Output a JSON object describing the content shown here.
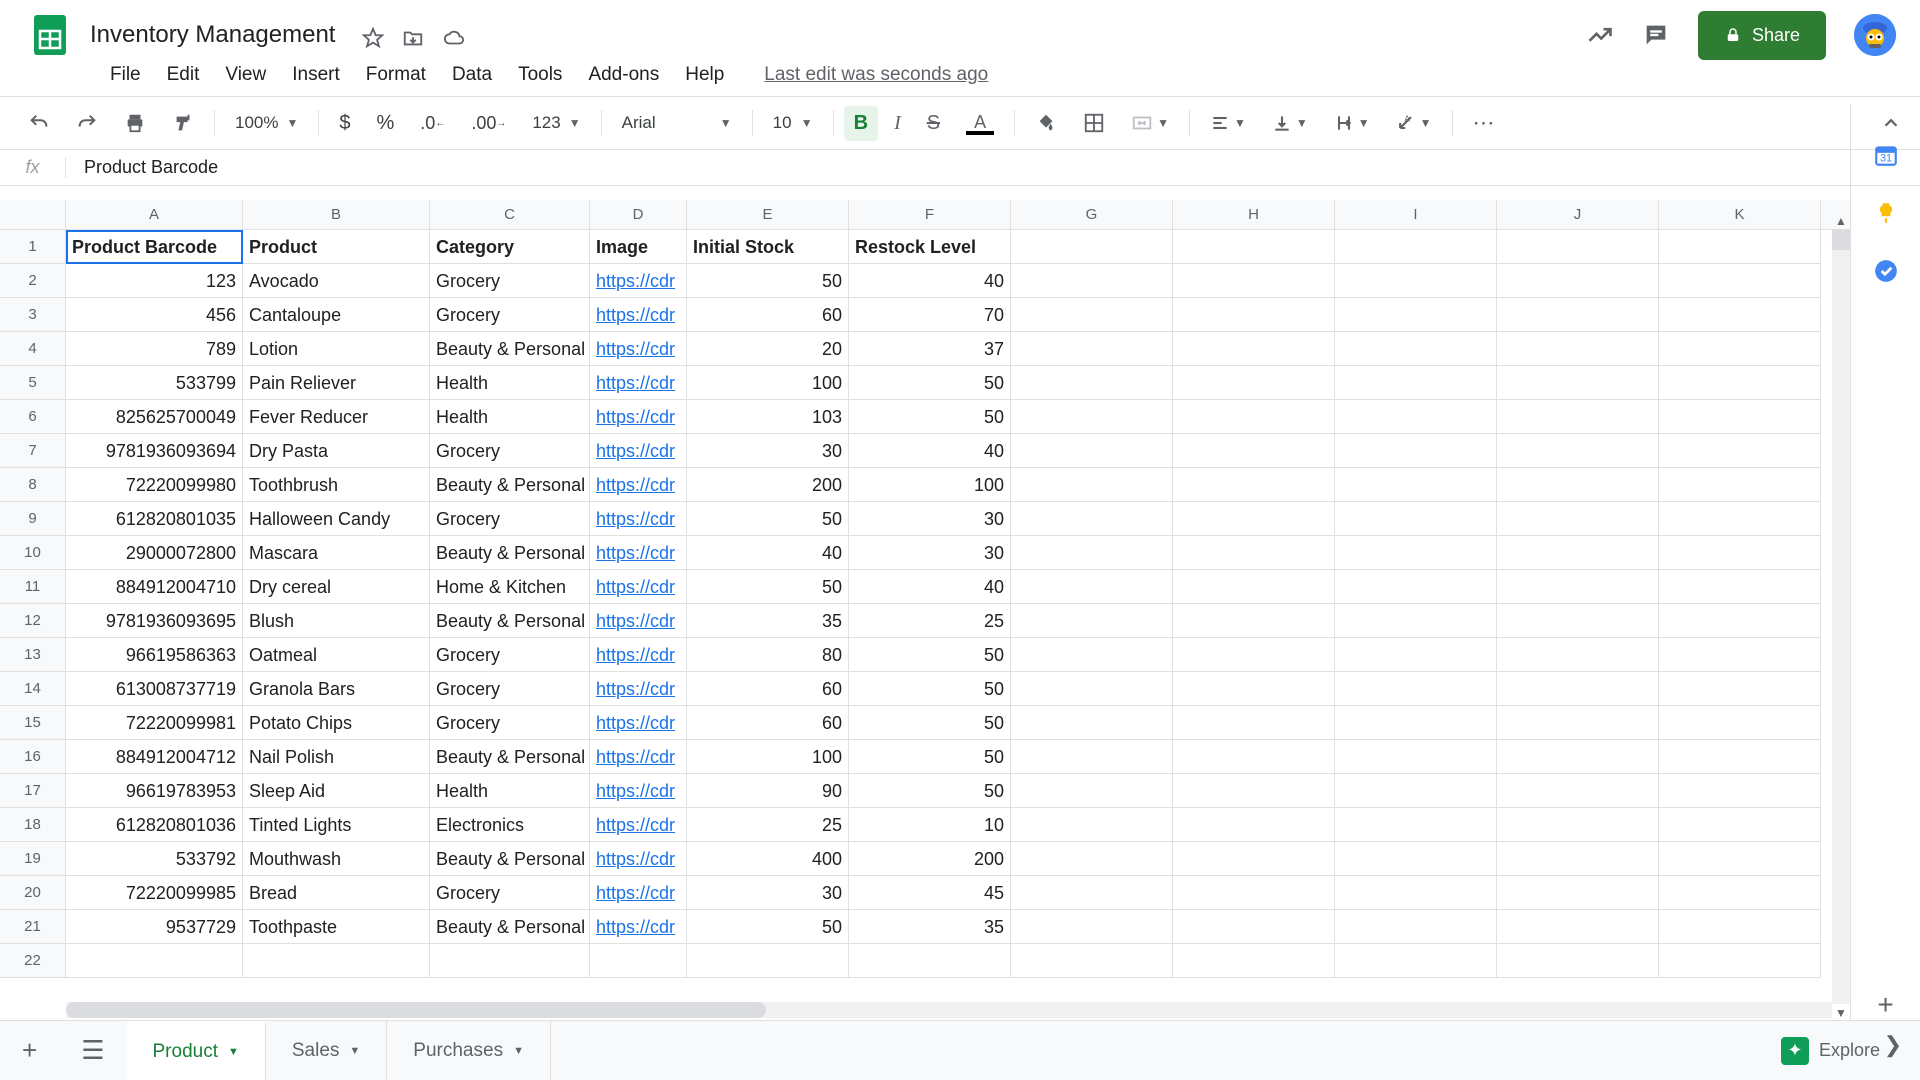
{
  "doc_title": "Inventory Management",
  "menus": [
    "File",
    "Edit",
    "View",
    "Insert",
    "Format",
    "Data",
    "Tools",
    "Add-ons",
    "Help"
  ],
  "last_edit": "Last edit was seconds ago",
  "toolbar": {
    "zoom": "100%",
    "font": "Arial",
    "font_size": "10",
    "num_fmt": "123"
  },
  "share_label": "Share",
  "formula_value": "Product Barcode",
  "active_cell": "A1",
  "columns": [
    "A",
    "B",
    "C",
    "D",
    "E",
    "F",
    "G",
    "H",
    "I",
    "J",
    "K"
  ],
  "col_widths": [
    "cA",
    "cB",
    "cC",
    "cD",
    "cE",
    "cF",
    "cG",
    "cH",
    "cI",
    "cJ",
    "cK"
  ],
  "headers": [
    "Product Barcode",
    "Product",
    "Category",
    "Image",
    "Initial Stock",
    "Restock Level"
  ],
  "rows": [
    {
      "barcode": "123",
      "product": "Avocado",
      "category": "Grocery",
      "image": "https://cdr",
      "initial": "50",
      "restock": "40"
    },
    {
      "barcode": "456",
      "product": "Cantaloupe",
      "category": "Grocery",
      "image": "https://cdr",
      "initial": "60",
      "restock": "70"
    },
    {
      "barcode": "789",
      "product": "Lotion",
      "category": "Beauty & Personal",
      "image": "https://cdr",
      "initial": "20",
      "restock": "37"
    },
    {
      "barcode": "533799",
      "product": "Pain Reliever",
      "category": "Health",
      "image": "https://cdr",
      "initial": "100",
      "restock": "50"
    },
    {
      "barcode": "825625700049",
      "product": "Fever Reducer",
      "category": "Health",
      "image": "https://cdr",
      "initial": "103",
      "restock": "50"
    },
    {
      "barcode": "9781936093694",
      "product": "Dry Pasta",
      "category": "Grocery",
      "image": "https://cdr",
      "initial": "30",
      "restock": "40"
    },
    {
      "barcode": "72220099980",
      "product": "Toothbrush",
      "category": "Beauty & Personal",
      "image": "https://cdr",
      "initial": "200",
      "restock": "100"
    },
    {
      "barcode": "612820801035",
      "product": "Halloween Candy",
      "category": "Grocery",
      "image": "https://cdr",
      "initial": "50",
      "restock": "30"
    },
    {
      "barcode": "29000072800",
      "product": "Mascara",
      "category": "Beauty & Personal",
      "image": "https://cdr",
      "initial": "40",
      "restock": "30"
    },
    {
      "barcode": "884912004710",
      "product": "Dry cereal",
      "category": "Home & Kitchen",
      "image": "https://cdr",
      "initial": "50",
      "restock": "40"
    },
    {
      "barcode": "9781936093695",
      "product": "Blush",
      "category": "Beauty & Personal",
      "image": "https://cdr",
      "initial": "35",
      "restock": "25"
    },
    {
      "barcode": "96619586363",
      "product": "Oatmeal",
      "category": "Grocery",
      "image": "https://cdr",
      "initial": "80",
      "restock": "50"
    },
    {
      "barcode": "613008737719",
      "product": "Granola Bars",
      "category": "Grocery",
      "image": "https://cdr",
      "initial": "60",
      "restock": "50"
    },
    {
      "barcode": "72220099981",
      "product": "Potato Chips",
      "category": "Grocery",
      "image": "https://cdr",
      "initial": "60",
      "restock": "50"
    },
    {
      "barcode": "884912004712",
      "product": "Nail Polish",
      "category": "Beauty & Personal",
      "image": "https://cdr",
      "initial": "100",
      "restock": "50"
    },
    {
      "barcode": "96619783953",
      "product": "Sleep Aid",
      "category": "Health",
      "image": "https://cdr",
      "initial": "90",
      "restock": "50"
    },
    {
      "barcode": "612820801036",
      "product": "Tinted Lights",
      "category": "Electronics",
      "image": "https://cdr",
      "initial": "25",
      "restock": "10"
    },
    {
      "barcode": "533792",
      "product": "Mouthwash",
      "category": "Beauty & Personal",
      "image": "https://cdr",
      "initial": "400",
      "restock": "200"
    },
    {
      "barcode": "72220099985",
      "product": "Bread",
      "category": "Grocery",
      "image": "https://cdr",
      "initial": "30",
      "restock": "45"
    },
    {
      "barcode": "9537729",
      "product": "Toothpaste",
      "category": "Beauty & Personal",
      "image": "https://cdr",
      "initial": "50",
      "restock": "35"
    }
  ],
  "empty_rows": 1,
  "sheet_tabs": [
    {
      "label": "Product",
      "active": true
    },
    {
      "label": "Sales",
      "active": false
    },
    {
      "label": "Purchases",
      "active": false
    }
  ],
  "explore_label": "Explore"
}
